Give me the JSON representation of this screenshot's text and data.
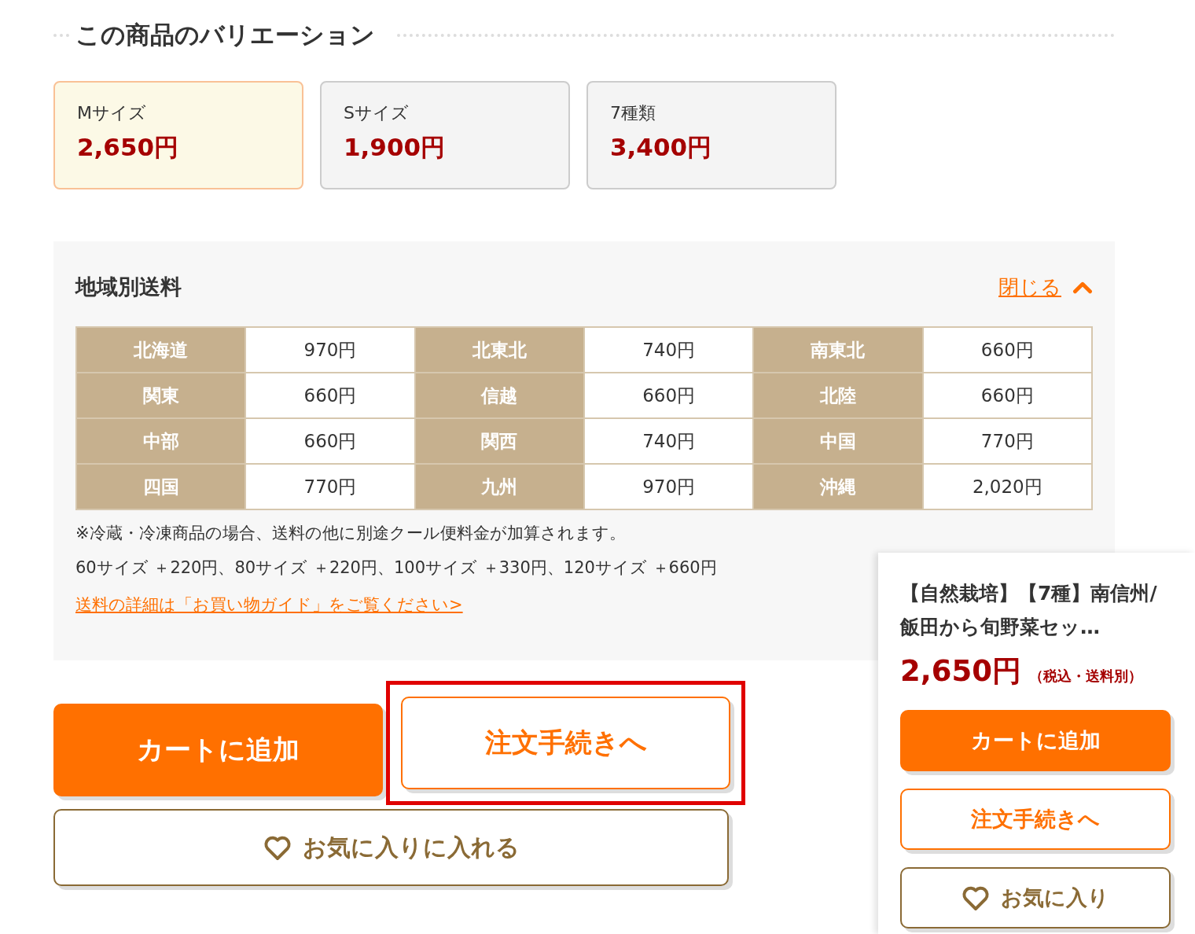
{
  "heading": {
    "title": "この商品のバリエーション"
  },
  "variations": [
    {
      "label": "Mサイズ",
      "price": "2,650円",
      "selected": true
    },
    {
      "label": "Sサイズ",
      "price": "1,900円",
      "selected": false
    },
    {
      "label": "7種類",
      "price": "3,400円",
      "selected": false
    }
  ],
  "shipping": {
    "title": "地域別送料",
    "toggle": {
      "label": "閉じる",
      "expanded": true
    },
    "rows": [
      [
        {
          "region": "北海道",
          "fee": "970円"
        },
        {
          "region": "北東北",
          "fee": "740円"
        },
        {
          "region": "南東北",
          "fee": "660円"
        }
      ],
      [
        {
          "region": "関東",
          "fee": "660円"
        },
        {
          "region": "信越",
          "fee": "660円"
        },
        {
          "region": "北陸",
          "fee": "660円"
        }
      ],
      [
        {
          "region": "中部",
          "fee": "660円"
        },
        {
          "region": "関西",
          "fee": "740円"
        },
        {
          "region": "中国",
          "fee": "770円"
        }
      ],
      [
        {
          "region": "四国",
          "fee": "770円"
        },
        {
          "region": "九州",
          "fee": "970円"
        },
        {
          "region": "沖縄",
          "fee": "2,020円"
        }
      ]
    ],
    "notes": [
      "※冷蔵・冷凍商品の場合、送料の他に別途クール便料金が加算されます。",
      "60サイズ ＋220円、80サイズ ＋220円、100サイズ ＋330円、120サイズ ＋660円"
    ],
    "link": "送料の詳細は「お買い物ガイド」をご覧ください>"
  },
  "actions": {
    "add_to_cart": "カートに追加",
    "checkout": "注文手続きへ",
    "checkout_highlighted": true,
    "favorite": "お気に入りに入れる"
  },
  "floating_card": {
    "title": "【自然栽培】【7種】南信州/飯田から旬野菜セッ…",
    "price": "2,650円",
    "tax_note": "（税込・送料別）",
    "add_to_cart": "カートに追加",
    "checkout": "注文手続きへ",
    "favorite": "お気に入り"
  }
}
